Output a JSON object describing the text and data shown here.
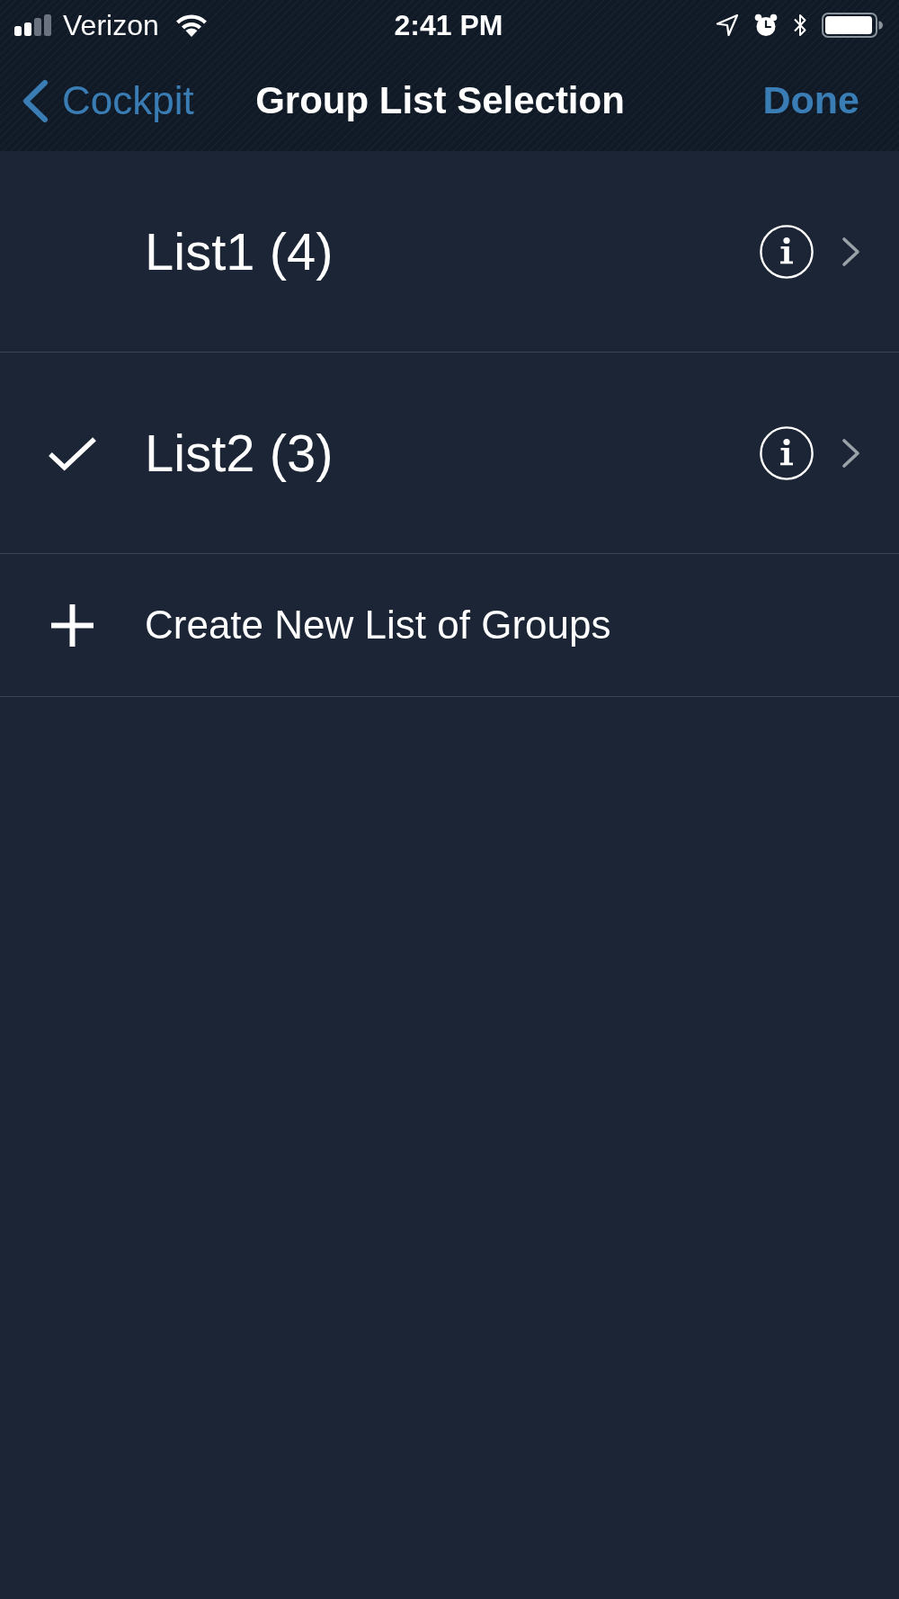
{
  "status_bar": {
    "carrier": "Verizon",
    "time": "2:41 PM"
  },
  "nav_bar": {
    "back_label": "Cockpit",
    "title": "Group List Selection",
    "done_label": "Done"
  },
  "lists": [
    {
      "label": "List1 (4)",
      "selected": false
    },
    {
      "label": "List2 (3)",
      "selected": true
    }
  ],
  "create_row": {
    "label": "Create New List of Groups"
  }
}
